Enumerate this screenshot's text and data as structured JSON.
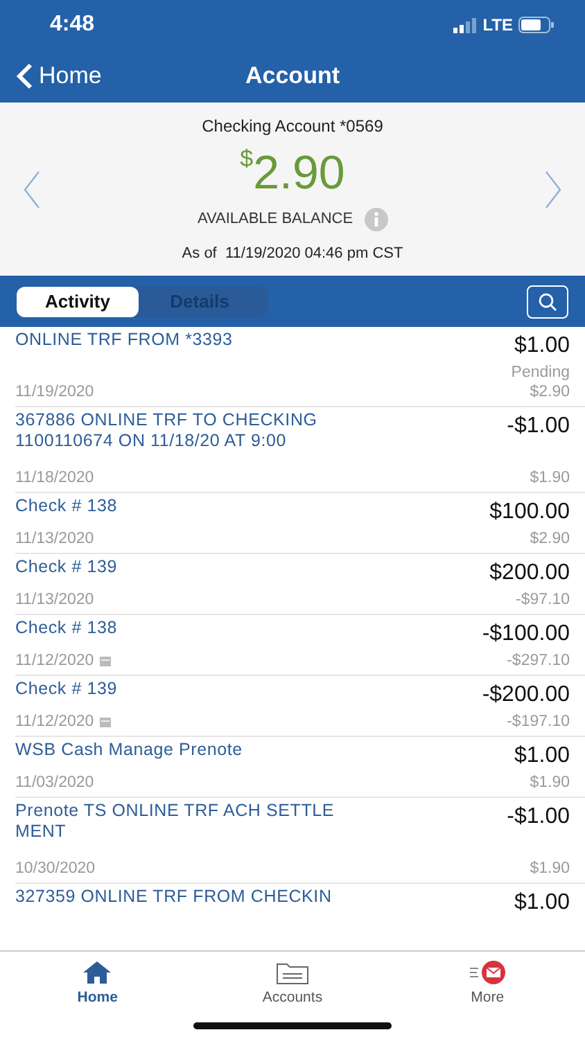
{
  "status_bar": {
    "time": "4:48",
    "network": "LTE"
  },
  "nav": {
    "back": "Home",
    "title": "Account"
  },
  "account": {
    "name": "Checking Account *0569",
    "currency": "$",
    "balance": "2.90",
    "balance_label": "AVAILABLE BALANCE",
    "as_of": "As of  11/19/2020 04:46 pm CST"
  },
  "tabs": [
    {
      "label": "Activity",
      "selected": true
    },
    {
      "label": "Details",
      "selected": false
    }
  ],
  "transactions": [
    {
      "description": "ONLINE TRF FROM *3393",
      "amount": "$1.00",
      "date": "11/19/2020",
      "status": "Pending",
      "balance": "$2.90",
      "has_image": false
    },
    {
      "description": "367886 ONLINE TRF TO CHECKING 1100110674 ON 11/18/20 AT 9:00",
      "amount": "-$1.00",
      "date": "11/18/2020",
      "balance": "$1.90",
      "has_image": false
    },
    {
      "description": "Check # 138",
      "amount": "$100.00",
      "date": "11/13/2020",
      "balance": "$2.90",
      "has_image": false
    },
    {
      "description": "Check # 139",
      "amount": "$200.00",
      "date": "11/13/2020",
      "balance": "-$97.10",
      "has_image": false
    },
    {
      "description": "Check # 138",
      "amount": "-$100.00",
      "date": "11/12/2020",
      "balance": "-$297.10",
      "has_image": true
    },
    {
      "description": "Check # 139",
      "amount": "-$200.00",
      "date": "11/12/2020",
      "balance": "-$197.10",
      "has_image": true
    },
    {
      "description": "WSB Cash Manage Prenote",
      "amount": "$1.00",
      "date": "11/03/2020",
      "balance": "$1.90",
      "has_image": false
    },
    {
      "description": "Prenote TS ONLINE TRF ACH SETTLE MENT",
      "amount": "-$1.00",
      "date": "10/30/2020",
      "balance": "$1.90",
      "has_image": false
    },
    {
      "description": "327359 ONLINE TRF FROM CHECKIN",
      "amount": "$1.00"
    }
  ],
  "tab_bar": [
    {
      "label": "Home",
      "selected": true,
      "kind": "home"
    },
    {
      "label": "Accounts",
      "selected": false,
      "kind": "accounts"
    },
    {
      "label": "More",
      "selected": false,
      "kind": "more"
    }
  ]
}
